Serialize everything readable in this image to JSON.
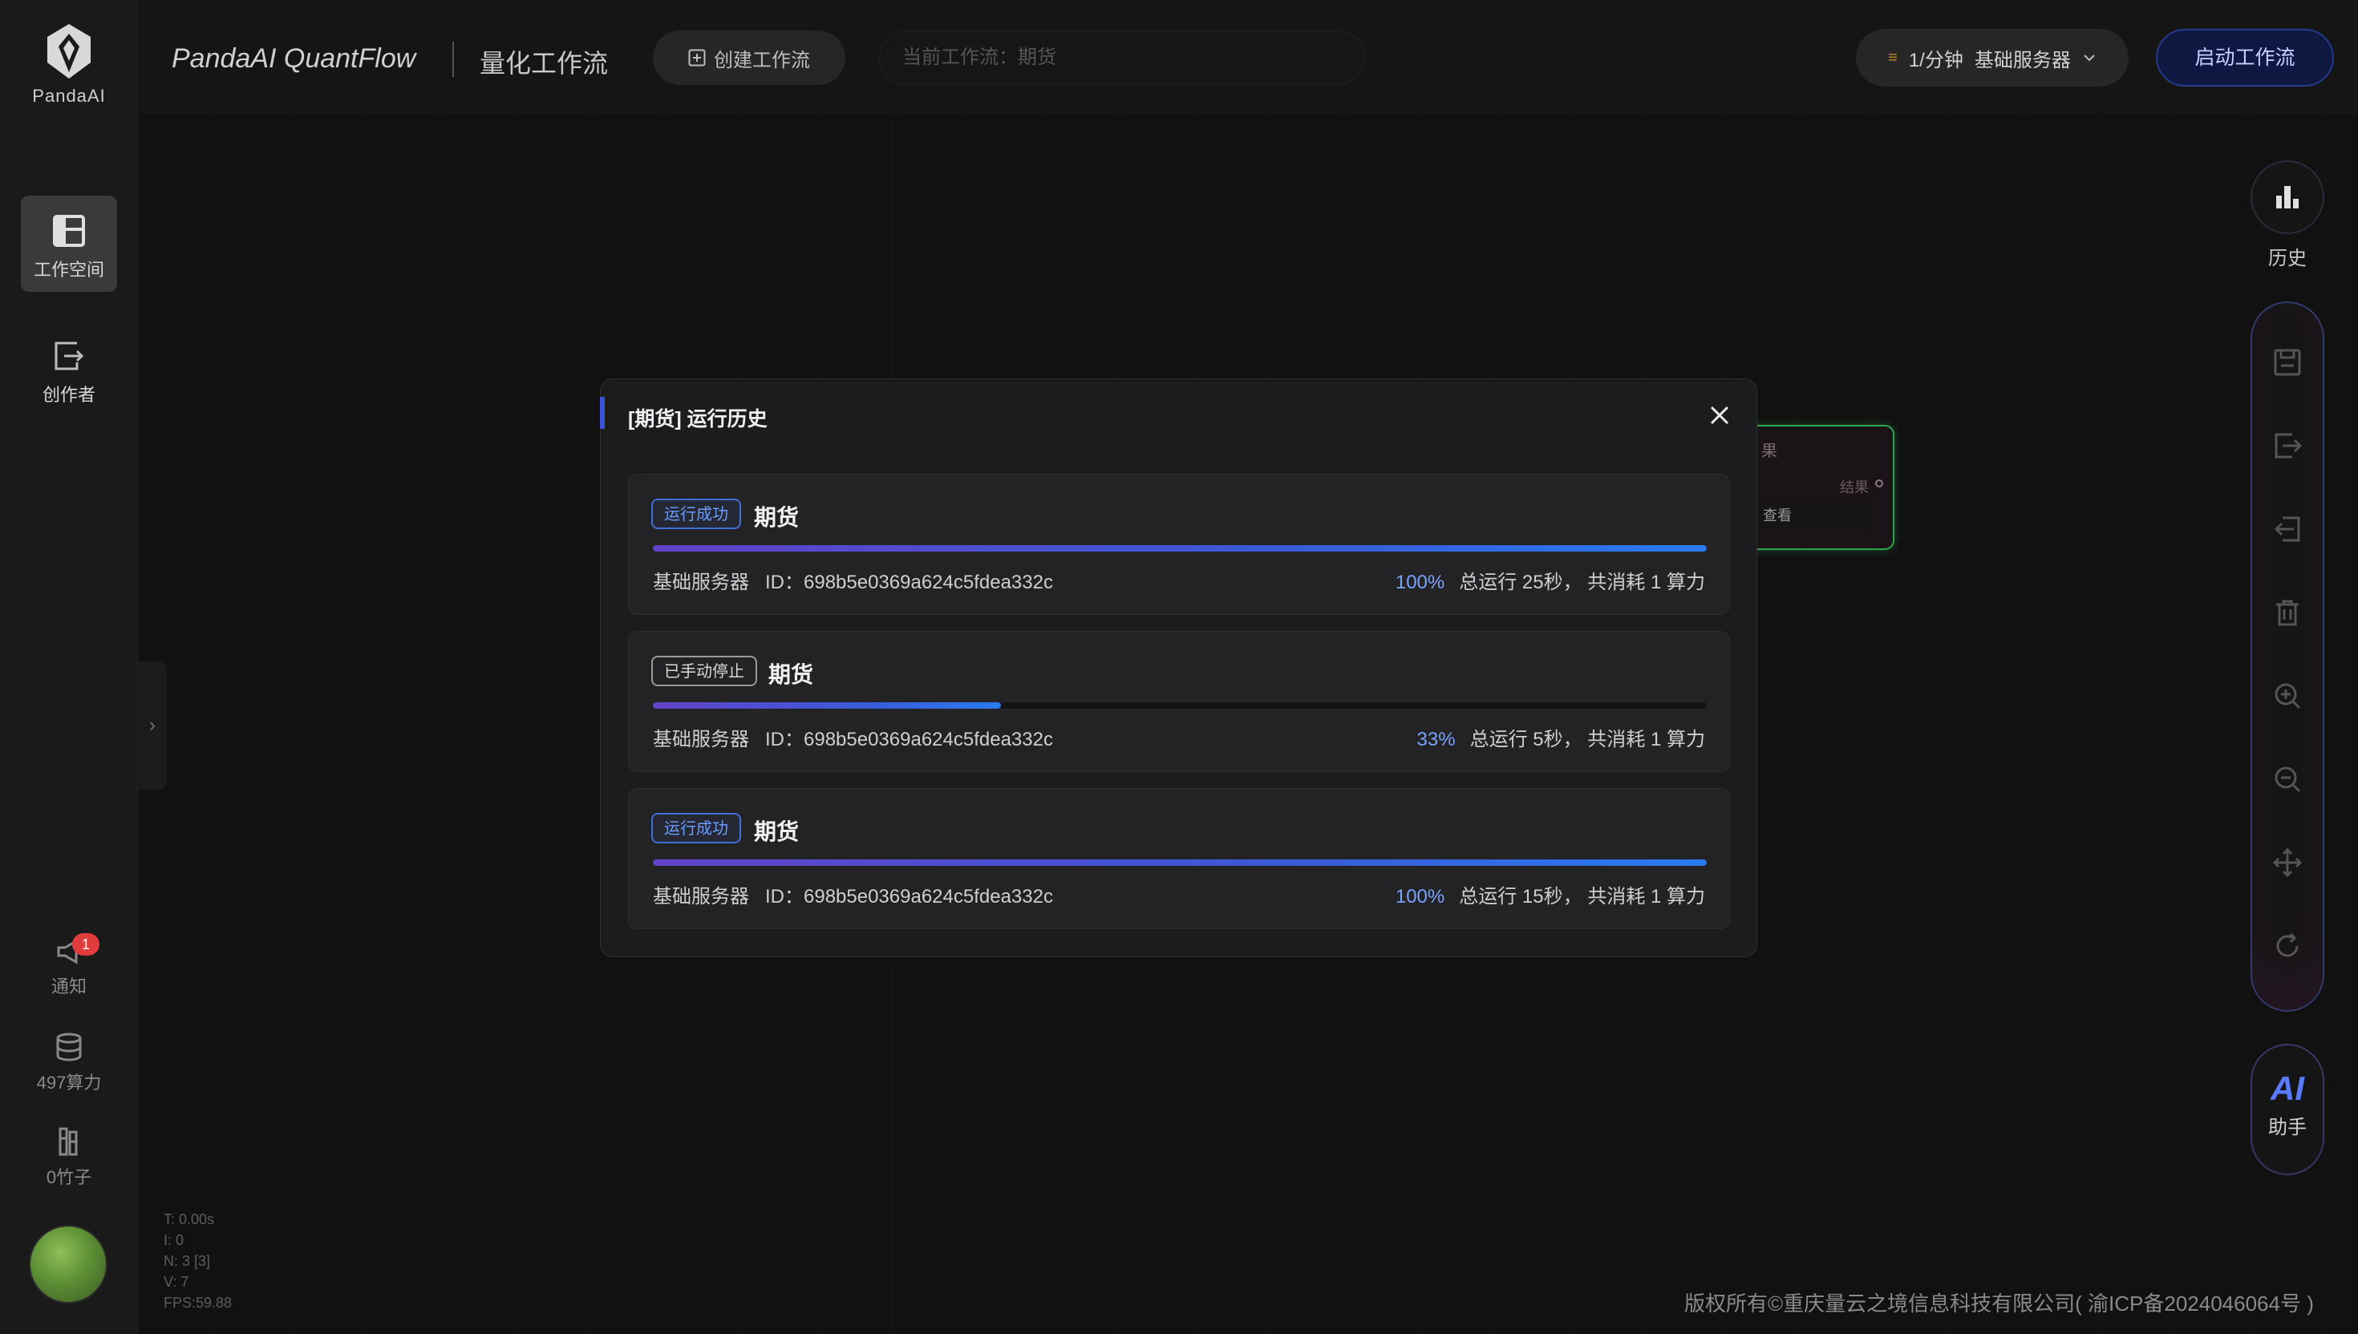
{
  "brand": {
    "logo_text": "PandaAI",
    "app_name": "PandaAI QuantFlow",
    "subtitle": "量化工作流"
  },
  "sidebar": {
    "items": [
      {
        "label": "工作空间",
        "icon": "workspace-icon",
        "active": true
      },
      {
        "label": "创作者",
        "icon": "creator-icon",
        "active": false
      }
    ],
    "notify": {
      "label": "通知",
      "badge": "1"
    },
    "compute": {
      "label": "497算力"
    },
    "bamboo": {
      "label": "0竹子"
    }
  },
  "topbar": {
    "create_label": "创建工作流",
    "current_flow_label": "当前工作流：",
    "current_flow_value": "期货",
    "rate": "1/分钟",
    "server": "基础服务器",
    "start_label": "启动工作流"
  },
  "rail": {
    "history_label": "历史",
    "ai_label": "AI",
    "assistant_label": "助手"
  },
  "node": {
    "title": "果",
    "output": "结果",
    "view": "查看"
  },
  "stats": {
    "t": "T: 0.00s",
    "i": "I: 0",
    "n": "N: 3 [3]",
    "v": "V: 7",
    "fps": "FPS:59.88"
  },
  "modal": {
    "title": "[期货] 运行历史",
    "runs": [
      {
        "status": "运行成功",
        "status_type": "ok",
        "name": "期货",
        "progress": 1.0,
        "server": "基础服务器",
        "id_label": "ID：",
        "id": "698b5e0369a624c5fdea332c",
        "pct": "100%",
        "summary_a": "总运行",
        "duration": "25秒",
        "summary_b": "，  共消耗",
        "cost": "1",
        "unit": "算力"
      },
      {
        "status": "已手动停止",
        "status_type": "stop",
        "name": "期货",
        "progress": 0.33,
        "server": "基础服务器",
        "id_label": "ID：",
        "id": "698b5e0369a624c5fdea332c",
        "pct": "33%",
        "summary_a": "总运行",
        "duration": "5秒",
        "summary_b": "，  共消耗",
        "cost": "1",
        "unit": "算力"
      },
      {
        "status": "运行成功",
        "status_type": "ok",
        "name": "期货",
        "progress": 1.0,
        "server": "基础服务器",
        "id_label": "ID：",
        "id": "698b5e0369a624c5fdea332c",
        "pct": "100%",
        "summary_a": "总运行",
        "duration": "15秒",
        "summary_b": "，  共消耗",
        "cost": "1",
        "unit": "算力"
      }
    ]
  },
  "footer": {
    "copyright": "版权所有©重庆量云之境信息科技有限公司( 渝ICP备2024046064号 )"
  },
  "colors": {
    "accent": "#3c55d8",
    "success_tag": "#3e6fd8",
    "badge": "#e03c3c",
    "node_border": "#2ea44f"
  }
}
